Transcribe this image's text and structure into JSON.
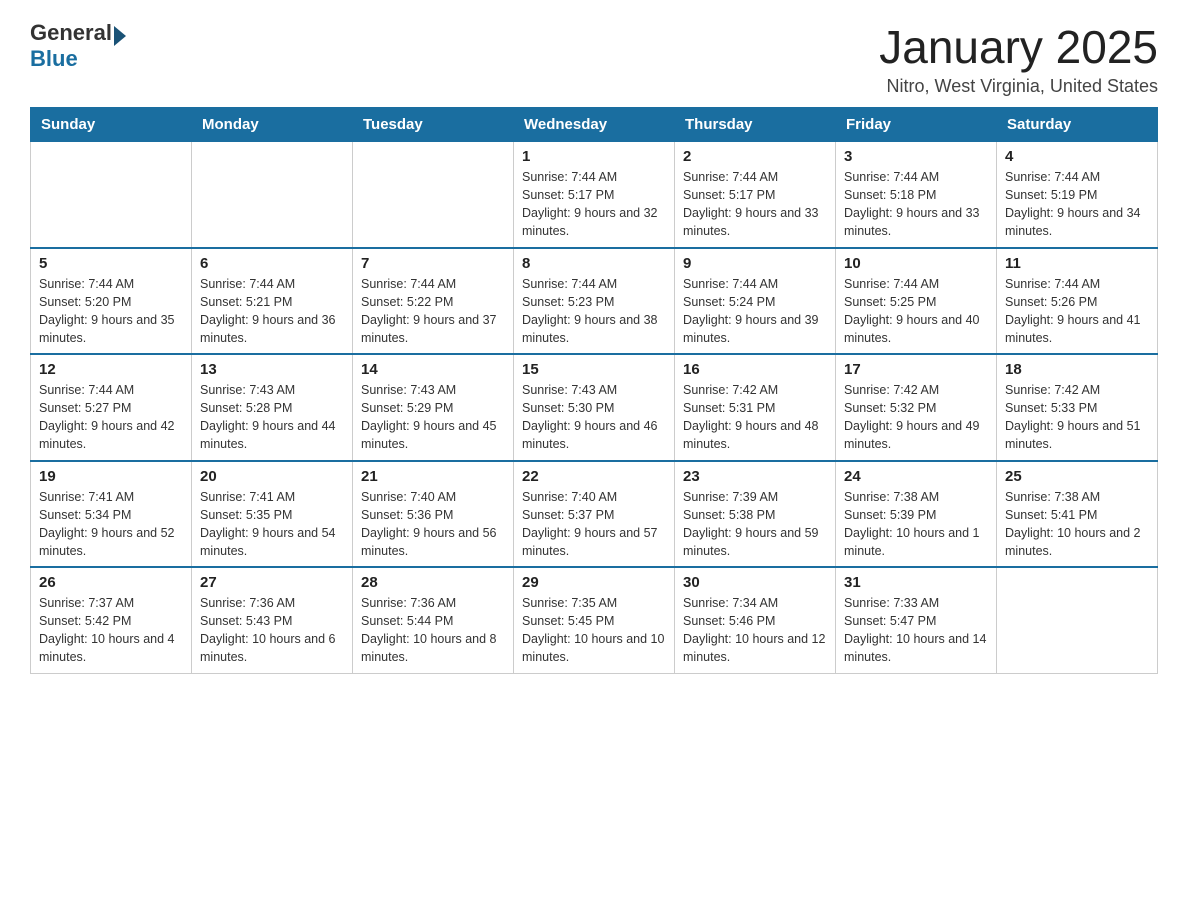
{
  "header": {
    "logo_general": "General",
    "logo_blue": "Blue",
    "title": "January 2025",
    "subtitle": "Nitro, West Virginia, United States"
  },
  "weekdays": [
    "Sunday",
    "Monday",
    "Tuesday",
    "Wednesday",
    "Thursday",
    "Friday",
    "Saturday"
  ],
  "weeks": [
    [
      {
        "day": "",
        "info": ""
      },
      {
        "day": "",
        "info": ""
      },
      {
        "day": "",
        "info": ""
      },
      {
        "day": "1",
        "info": "Sunrise: 7:44 AM\nSunset: 5:17 PM\nDaylight: 9 hours and 32 minutes."
      },
      {
        "day": "2",
        "info": "Sunrise: 7:44 AM\nSunset: 5:17 PM\nDaylight: 9 hours and 33 minutes."
      },
      {
        "day": "3",
        "info": "Sunrise: 7:44 AM\nSunset: 5:18 PM\nDaylight: 9 hours and 33 minutes."
      },
      {
        "day": "4",
        "info": "Sunrise: 7:44 AM\nSunset: 5:19 PM\nDaylight: 9 hours and 34 minutes."
      }
    ],
    [
      {
        "day": "5",
        "info": "Sunrise: 7:44 AM\nSunset: 5:20 PM\nDaylight: 9 hours and 35 minutes."
      },
      {
        "day": "6",
        "info": "Sunrise: 7:44 AM\nSunset: 5:21 PM\nDaylight: 9 hours and 36 minutes."
      },
      {
        "day": "7",
        "info": "Sunrise: 7:44 AM\nSunset: 5:22 PM\nDaylight: 9 hours and 37 minutes."
      },
      {
        "day": "8",
        "info": "Sunrise: 7:44 AM\nSunset: 5:23 PM\nDaylight: 9 hours and 38 minutes."
      },
      {
        "day": "9",
        "info": "Sunrise: 7:44 AM\nSunset: 5:24 PM\nDaylight: 9 hours and 39 minutes."
      },
      {
        "day": "10",
        "info": "Sunrise: 7:44 AM\nSunset: 5:25 PM\nDaylight: 9 hours and 40 minutes."
      },
      {
        "day": "11",
        "info": "Sunrise: 7:44 AM\nSunset: 5:26 PM\nDaylight: 9 hours and 41 minutes."
      }
    ],
    [
      {
        "day": "12",
        "info": "Sunrise: 7:44 AM\nSunset: 5:27 PM\nDaylight: 9 hours and 42 minutes."
      },
      {
        "day": "13",
        "info": "Sunrise: 7:43 AM\nSunset: 5:28 PM\nDaylight: 9 hours and 44 minutes."
      },
      {
        "day": "14",
        "info": "Sunrise: 7:43 AM\nSunset: 5:29 PM\nDaylight: 9 hours and 45 minutes."
      },
      {
        "day": "15",
        "info": "Sunrise: 7:43 AM\nSunset: 5:30 PM\nDaylight: 9 hours and 46 minutes."
      },
      {
        "day": "16",
        "info": "Sunrise: 7:42 AM\nSunset: 5:31 PM\nDaylight: 9 hours and 48 minutes."
      },
      {
        "day": "17",
        "info": "Sunrise: 7:42 AM\nSunset: 5:32 PM\nDaylight: 9 hours and 49 minutes."
      },
      {
        "day": "18",
        "info": "Sunrise: 7:42 AM\nSunset: 5:33 PM\nDaylight: 9 hours and 51 minutes."
      }
    ],
    [
      {
        "day": "19",
        "info": "Sunrise: 7:41 AM\nSunset: 5:34 PM\nDaylight: 9 hours and 52 minutes."
      },
      {
        "day": "20",
        "info": "Sunrise: 7:41 AM\nSunset: 5:35 PM\nDaylight: 9 hours and 54 minutes."
      },
      {
        "day": "21",
        "info": "Sunrise: 7:40 AM\nSunset: 5:36 PM\nDaylight: 9 hours and 56 minutes."
      },
      {
        "day": "22",
        "info": "Sunrise: 7:40 AM\nSunset: 5:37 PM\nDaylight: 9 hours and 57 minutes."
      },
      {
        "day": "23",
        "info": "Sunrise: 7:39 AM\nSunset: 5:38 PM\nDaylight: 9 hours and 59 minutes."
      },
      {
        "day": "24",
        "info": "Sunrise: 7:38 AM\nSunset: 5:39 PM\nDaylight: 10 hours and 1 minute."
      },
      {
        "day": "25",
        "info": "Sunrise: 7:38 AM\nSunset: 5:41 PM\nDaylight: 10 hours and 2 minutes."
      }
    ],
    [
      {
        "day": "26",
        "info": "Sunrise: 7:37 AM\nSunset: 5:42 PM\nDaylight: 10 hours and 4 minutes."
      },
      {
        "day": "27",
        "info": "Sunrise: 7:36 AM\nSunset: 5:43 PM\nDaylight: 10 hours and 6 minutes."
      },
      {
        "day": "28",
        "info": "Sunrise: 7:36 AM\nSunset: 5:44 PM\nDaylight: 10 hours and 8 minutes."
      },
      {
        "day": "29",
        "info": "Sunrise: 7:35 AM\nSunset: 5:45 PM\nDaylight: 10 hours and 10 minutes."
      },
      {
        "day": "30",
        "info": "Sunrise: 7:34 AM\nSunset: 5:46 PM\nDaylight: 10 hours and 12 minutes."
      },
      {
        "day": "31",
        "info": "Sunrise: 7:33 AM\nSunset: 5:47 PM\nDaylight: 10 hours and 14 minutes."
      },
      {
        "day": "",
        "info": ""
      }
    ]
  ]
}
